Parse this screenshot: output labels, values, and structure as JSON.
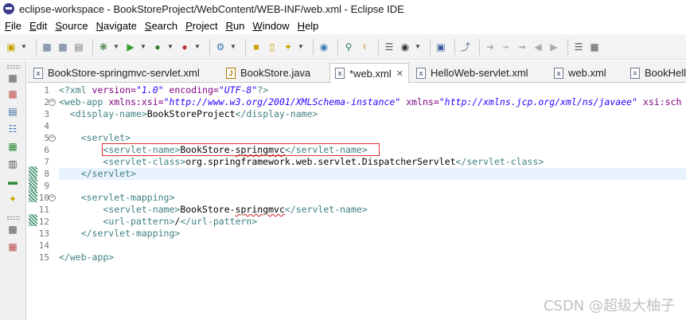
{
  "window": {
    "title": "eclipse-workspace - BookStoreProject/WebContent/WEB-INF/web.xml - Eclipse IDE"
  },
  "menu": [
    {
      "u": "F",
      "rest": "ile"
    },
    {
      "u": "E",
      "rest": "dit"
    },
    {
      "u": "S",
      "rest": "ource"
    },
    {
      "u": "N",
      "rest": "avigate"
    },
    {
      "u": "S",
      "rest": "earch"
    },
    {
      "u": "P",
      "rest": "roject"
    },
    {
      "u": "R",
      "rest": "un"
    },
    {
      "u": "W",
      "rest": "indow"
    },
    {
      "u": "H",
      "rest": "elp"
    }
  ],
  "tabs": [
    {
      "label": "BookStore-springmvc-servlet.xml",
      "icon": "xml-file-icon"
    },
    {
      "label": "BookStore.java",
      "icon": "java-file-icon"
    },
    {
      "label": "*web.xml",
      "icon": "xml-file-icon",
      "active": true
    },
    {
      "label": "HelloWeb-servlet.xml",
      "icon": "xml-file-icon"
    },
    {
      "label": "web.xml",
      "icon": "xml-file-icon"
    },
    {
      "label": "BookHell",
      "icon": "file-icon"
    }
  ],
  "editor": {
    "line_numbers": [
      "1",
      "2",
      "3",
      "4",
      "5",
      "6",
      "7",
      "8",
      "9",
      "10",
      "11",
      "12",
      "13",
      "14",
      "15"
    ],
    "lines": {
      "l1_decl": "<?xml ",
      "l1_a1": "version=",
      "l1_v1": "\"1.0\"",
      "l1_a2": " encoding=",
      "l1_v2": "\"UTF-8\"",
      "l1_end": "?>",
      "l2_open": "<web-app ",
      "l2_a1": "xmlns:xsi=",
      "l2_v1": "\"http://www.w3.org/2001/XMLSchema-instance\"",
      "l2_a2": " xmlns=",
      "l2_v2": "\"http://xmlns.jcp.org/xml/ns/javaee\"",
      "l2_a3": " xsi:sch",
      "l3_open": "<display-name>",
      "l3_text": "BookStoreProject",
      "l3_close": "</display-name>",
      "l5_tag": "<servlet>",
      "l6_open": "<servlet-name>",
      "l6_text_a": "BookStore-",
      "l6_text_b": "springmvc",
      "l6_close": "</servlet-name>",
      "l7_open": "<servlet-class>",
      "l7_text": "org.springframework.web.servlet.DispatcherServlet",
      "l7_close": "</servlet-class>",
      "l8_tag": "</servlet>",
      "l10_tag": "<servlet-mapping>",
      "l11_open": "<servlet-name>",
      "l11_text_a": "BookStore-",
      "l11_text_b": "springmvc",
      "l11_close": "</servlet-name>",
      "l12_open": "<url-pattern>",
      "l12_text": "/",
      "l12_close": "</url-pattern>",
      "l13_tag": "</servlet-mapping>",
      "l15_tag": "</web-app>"
    }
  },
  "watermark": "CSDN @超级大柚子"
}
